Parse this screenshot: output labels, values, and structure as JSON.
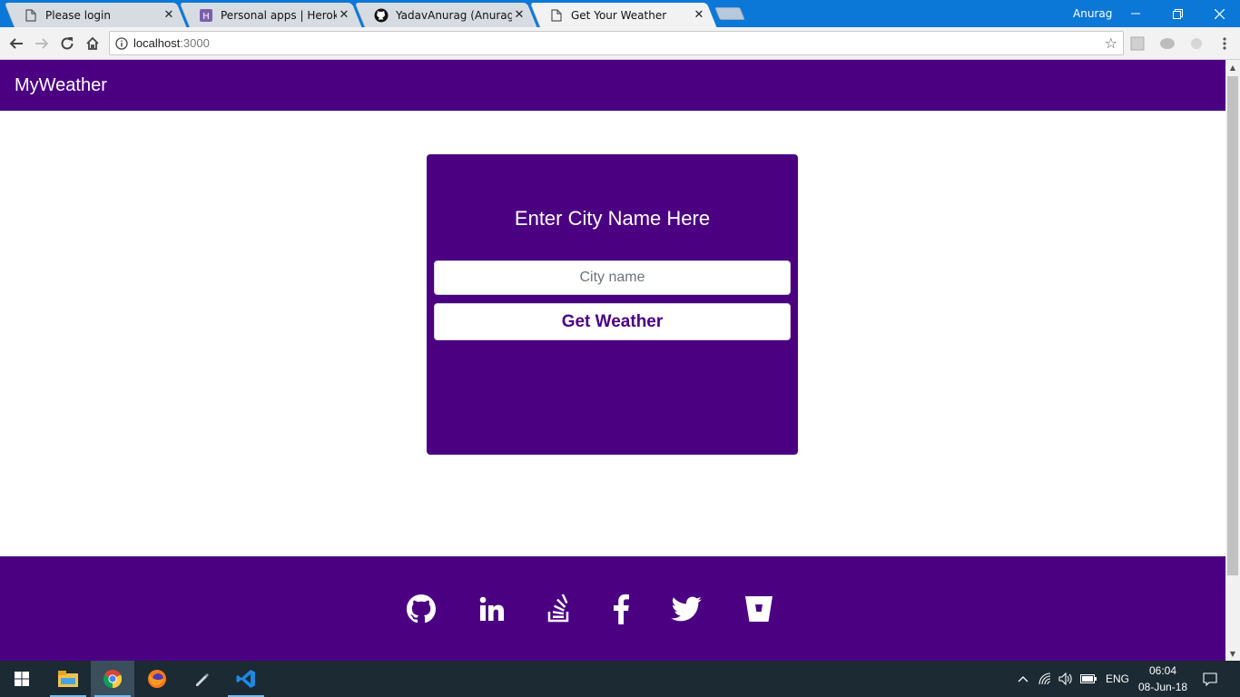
{
  "browser": {
    "tabs": [
      {
        "title": "Please login",
        "favicon": "page-icon",
        "active": false
      },
      {
        "title": "Personal apps | Heroku",
        "favicon": "heroku-icon",
        "active": false
      },
      {
        "title": "YadavAnurag (Anurag Ya",
        "favicon": "github-icon",
        "active": false
      },
      {
        "title": "Get Your Weather",
        "favicon": "page-icon",
        "active": true
      }
    ],
    "user_name": "Anurag",
    "url_host": "localhost",
    "url_port": ":3000"
  },
  "app": {
    "brand": "MyWeather",
    "accent_color": "#4b0082",
    "form": {
      "heading": "Enter City Name Here",
      "city_placeholder": "City name",
      "city_value": "",
      "submit_label": "Get Weather"
    },
    "footer_links": [
      "github-icon",
      "linkedin-icon",
      "stackoverflow-icon",
      "facebook-icon",
      "twitter-icon",
      "bitbucket-icon"
    ]
  },
  "taskbar": {
    "apps": [
      "file-explorer-icon",
      "chrome-icon",
      "firefox-icon",
      "pen-tool-icon",
      "vscode-icon"
    ],
    "language": "ENG",
    "time": "06:04",
    "date": "08-Jun-18"
  }
}
